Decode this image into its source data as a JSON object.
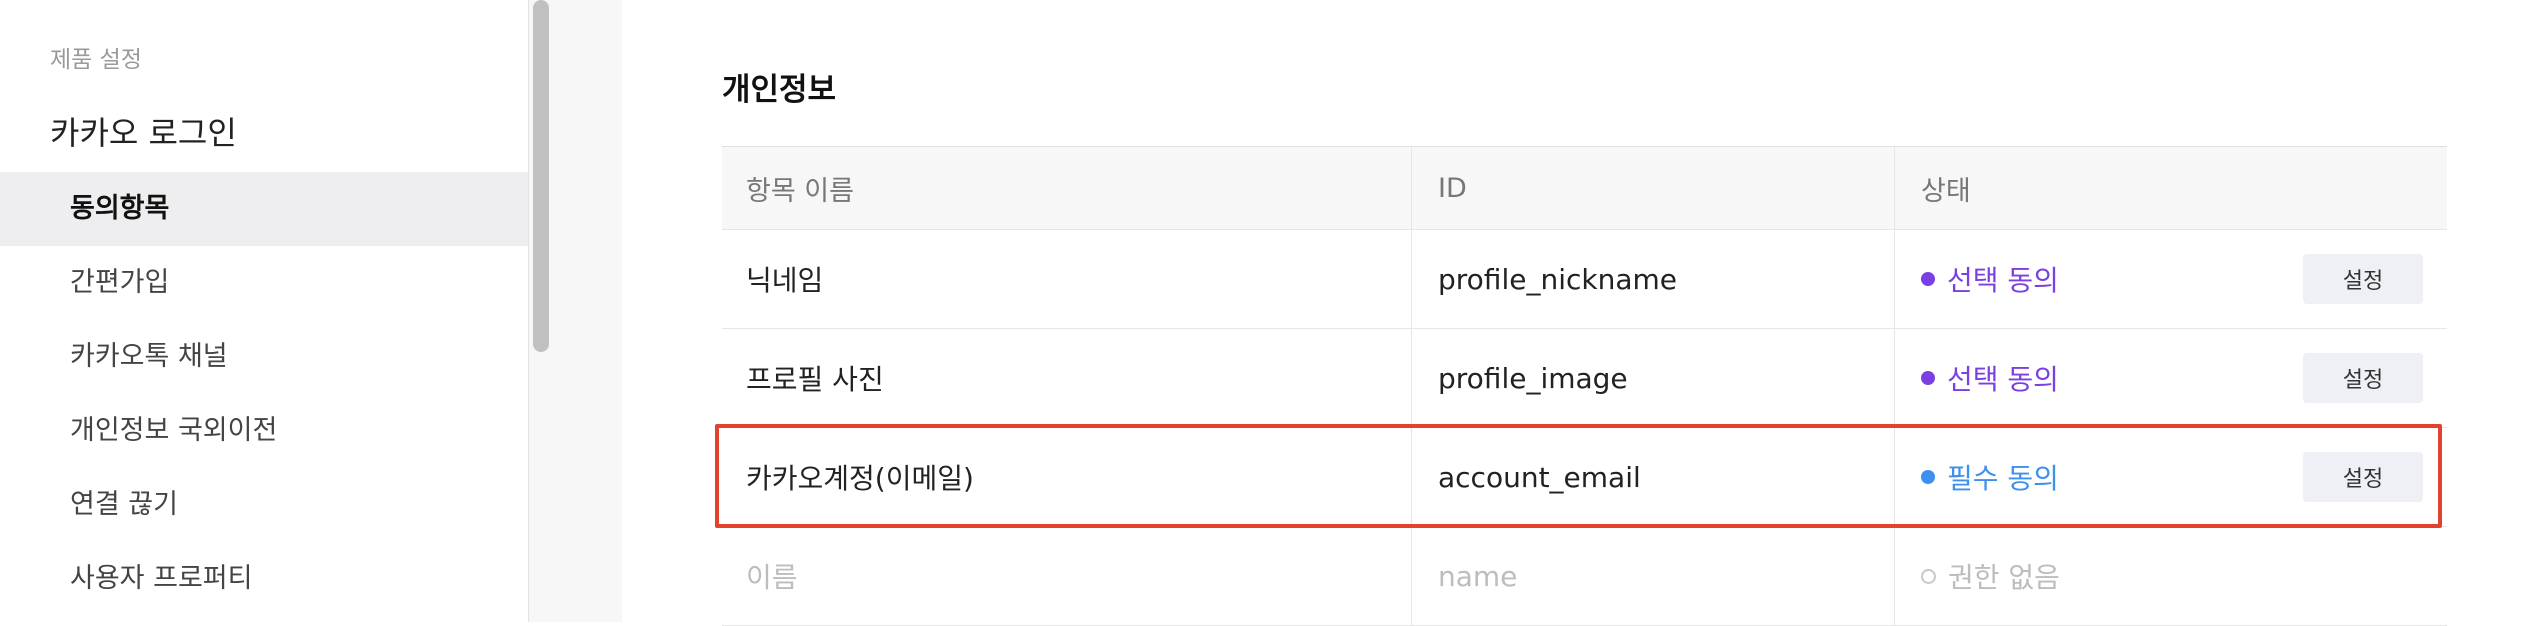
{
  "sidebar": {
    "section_label": "제품 설정",
    "title": "카카오 로그인",
    "items": [
      {
        "label": "동의항목",
        "active": true
      },
      {
        "label": "간편가입"
      },
      {
        "label": "카카오톡 채널"
      },
      {
        "label": "개인정보 국외이전"
      },
      {
        "label": "연결 끊기"
      },
      {
        "label": "사용자 프로퍼티"
      }
    ]
  },
  "main": {
    "section_title": "개인정보",
    "table": {
      "headers": {
        "name": "항목 이름",
        "id": "ID",
        "status": "상태"
      },
      "rows": [
        {
          "name": "닉네임",
          "id": "profile_nickname",
          "status": "선택 동의",
          "button": "설정"
        },
        {
          "name": "프로필 사진",
          "id": "profile_image",
          "status": "선택 동의",
          "button": "설정"
        },
        {
          "name": "카카오계정(이메일)",
          "id": "account_email",
          "status": "필수 동의",
          "button": "설정"
        },
        {
          "name": "이름",
          "id": "name",
          "status": "권한 없음"
        }
      ]
    }
  },
  "colors": {
    "optional_consent": "#7b3fe4",
    "required_consent": "#3d8ff0",
    "no_permission": "#bdbdbd",
    "highlight": "#e1432e"
  }
}
